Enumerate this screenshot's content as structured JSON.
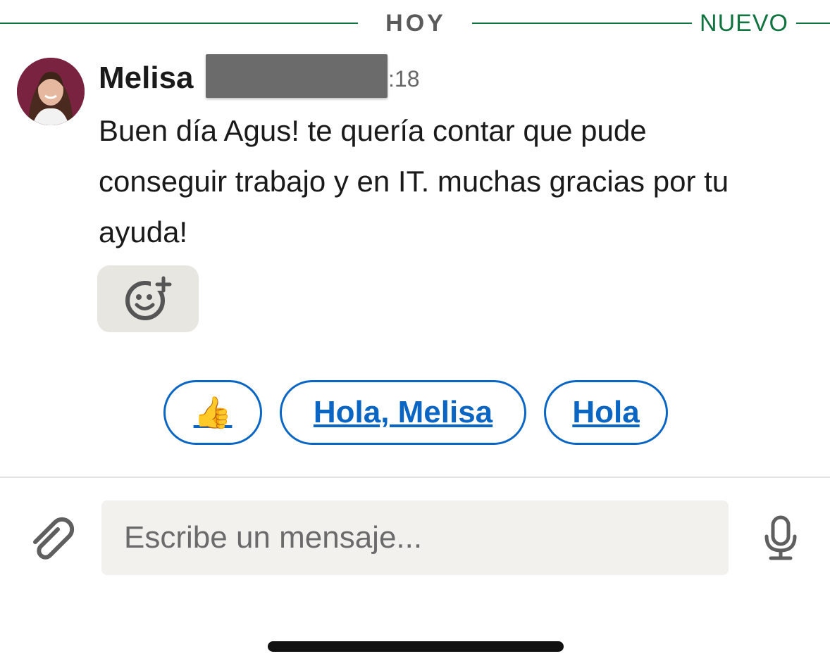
{
  "day_divider": {
    "label": "HOY",
    "new_label": "NUEVO"
  },
  "message": {
    "sender": "Melisa",
    "time_visible": ":18",
    "text": "Buen día Agus! te quería contar que pude conseguir trabajo y en IT. muchas gracias por tu ayuda!"
  },
  "reactions": {
    "add_reaction_icon": "add-emoji-icon"
  },
  "quick_replies": {
    "thumbs_up": "👍",
    "hola_melisa": "Hola, Melisa",
    "hola": "Hola"
  },
  "composer": {
    "placeholder": "Escribe un mensaje...",
    "attach_icon": "paperclip-icon",
    "mic_icon": "microphone-icon"
  },
  "colors": {
    "accent_green": "#11733f",
    "link_blue": "#0a66c2",
    "input_bg": "#f2f1ee",
    "reaction_bg": "#e8e6e1"
  }
}
